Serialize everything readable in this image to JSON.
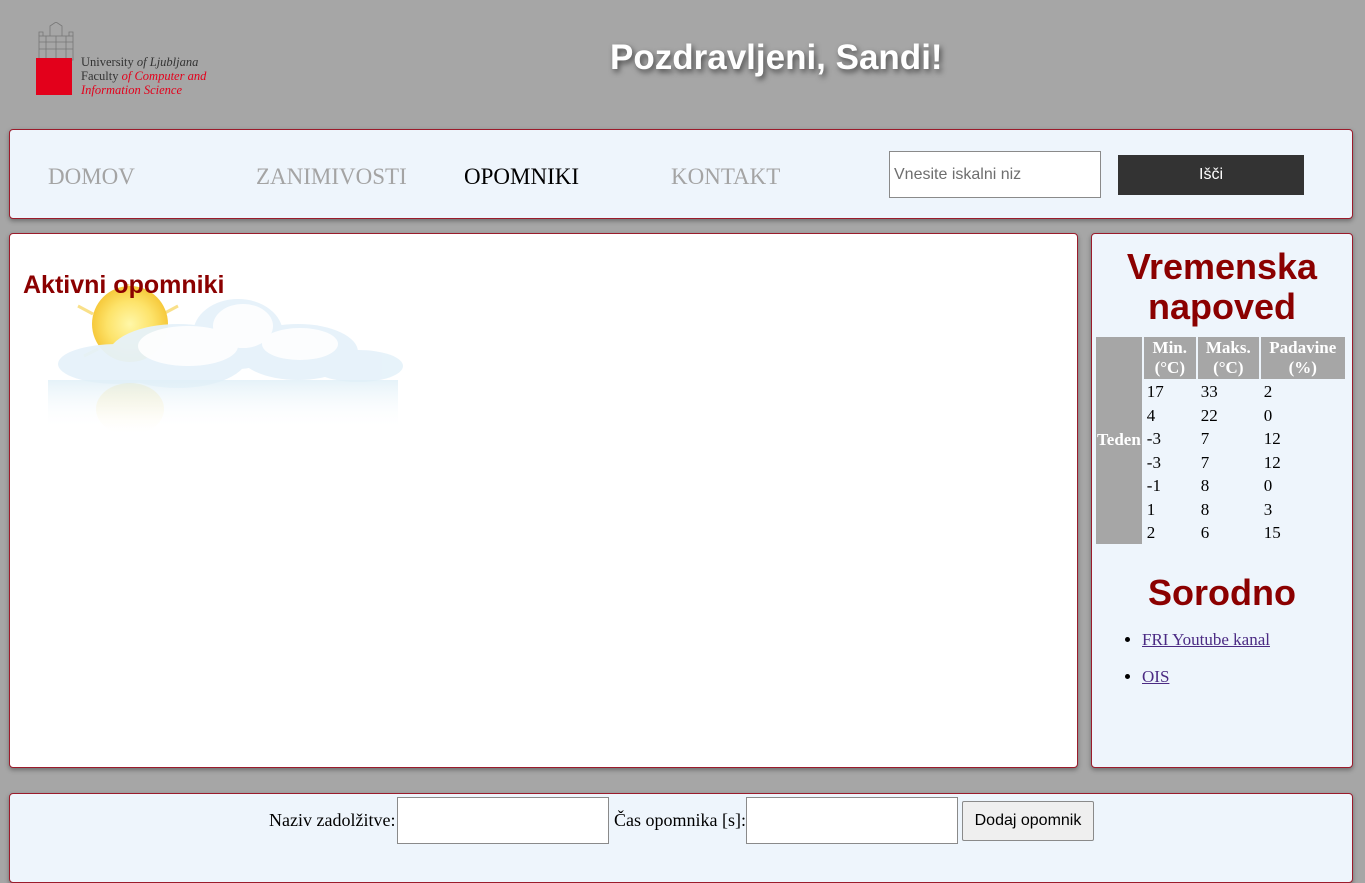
{
  "header": {
    "logo": {
      "line1_prefix": "University ",
      "line1_italic": "of Ljubljana",
      "line2_prefix": "Faculty ",
      "line2_red": "of Computer and",
      "line3": "Information Science",
      "brand_color": "#e3001b"
    },
    "greeting": "Pozdravljeni, Sandi!"
  },
  "nav": {
    "items": [
      {
        "label": "DOMOV",
        "active": false
      },
      {
        "label": "ZANIMIVOSTI",
        "active": false
      },
      {
        "label": "OPOMNIKI",
        "active": true
      },
      {
        "label": "KONTAKT",
        "active": false
      }
    ],
    "search": {
      "placeholder": "Vnesite iskalni niz",
      "value": ""
    },
    "search_button": "Išči"
  },
  "main": {
    "title": "Aktivni opomniki",
    "illustration": "sun-behind-cloud-icon"
  },
  "sidebar": {
    "weather_title_line1": "Vremenska",
    "weather_title_line2": "napoved",
    "table": {
      "row_header": "Teden",
      "columns": [
        {
          "line1": "Min.",
          "line2": "(°C)"
        },
        {
          "line1": "Maks.",
          "line2": "(°C)"
        },
        {
          "line1": "Padavine",
          "line2": "(%)"
        }
      ],
      "rows": [
        [
          "17",
          "33",
          "2"
        ],
        [
          "4",
          "22",
          "0"
        ],
        [
          "-3",
          "7",
          "12"
        ],
        [
          "-3",
          "7",
          "12"
        ],
        [
          "-1",
          "8",
          "0"
        ],
        [
          "1",
          "8",
          "3"
        ],
        [
          "2",
          "6",
          "15"
        ]
      ]
    },
    "related_title": "Sorodno",
    "links": [
      {
        "label": "FRI Youtube kanal"
      },
      {
        "label": "OIS"
      }
    ]
  },
  "form": {
    "task_label": "Naziv zadolžitve:",
    "task_value": "",
    "time_label": "Čas opomnika [s]:",
    "time_value": "",
    "add_button": "Dodaj opomnik"
  },
  "colors": {
    "background": "#a6a6a6",
    "panel": "#eef5fc",
    "panel_border": "#9b1b2b",
    "heading": "#8b0000",
    "nav_inactive": "#a4a4a4",
    "button_dark": "#333333"
  }
}
